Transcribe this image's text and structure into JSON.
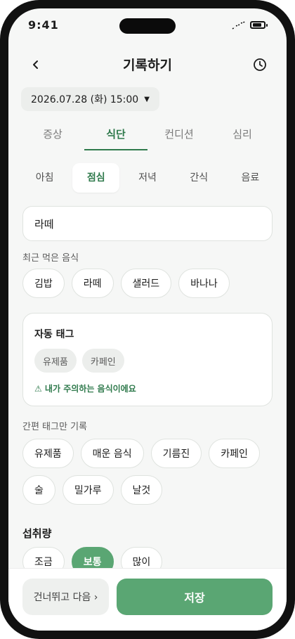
{
  "status": {
    "time": "9:41"
  },
  "header": {
    "title": "기록하기"
  },
  "date": {
    "label": "2026.07.28 (화) 15:00"
  },
  "main_tabs": [
    {
      "label": "증상"
    },
    {
      "label": "식단"
    },
    {
      "label": "컨디션"
    },
    {
      "label": "심리"
    }
  ],
  "sub_tabs": [
    {
      "label": "아침"
    },
    {
      "label": "점심"
    },
    {
      "label": "저녁"
    },
    {
      "label": "간식"
    },
    {
      "label": "음료"
    }
  ],
  "food_input": {
    "value": "라떼"
  },
  "recent": {
    "label": "최근 먹은 음식",
    "items": [
      "김밥",
      "라떼",
      "샐러드",
      "바나나"
    ]
  },
  "auto_tag": {
    "title": "자동 태그",
    "tags": [
      "유제품",
      "카페인"
    ],
    "warning": "⚠ 내가 주의하는 음식이에요"
  },
  "quick_tags": {
    "label": "간편 태그만 기록",
    "items": [
      "유제품",
      "매운 음식",
      "기름진",
      "카페인",
      "술",
      "밀가루",
      "날것"
    ]
  },
  "amount": {
    "title": "섭취량",
    "options": [
      "조금",
      "보통",
      "많이"
    ],
    "selected": "보통"
  },
  "actions": {
    "skip": "건너뛰고 다음 ›",
    "save": "저장"
  },
  "colors": {
    "accent": "#2f7a4c",
    "accent_fill": "#5aa673"
  }
}
